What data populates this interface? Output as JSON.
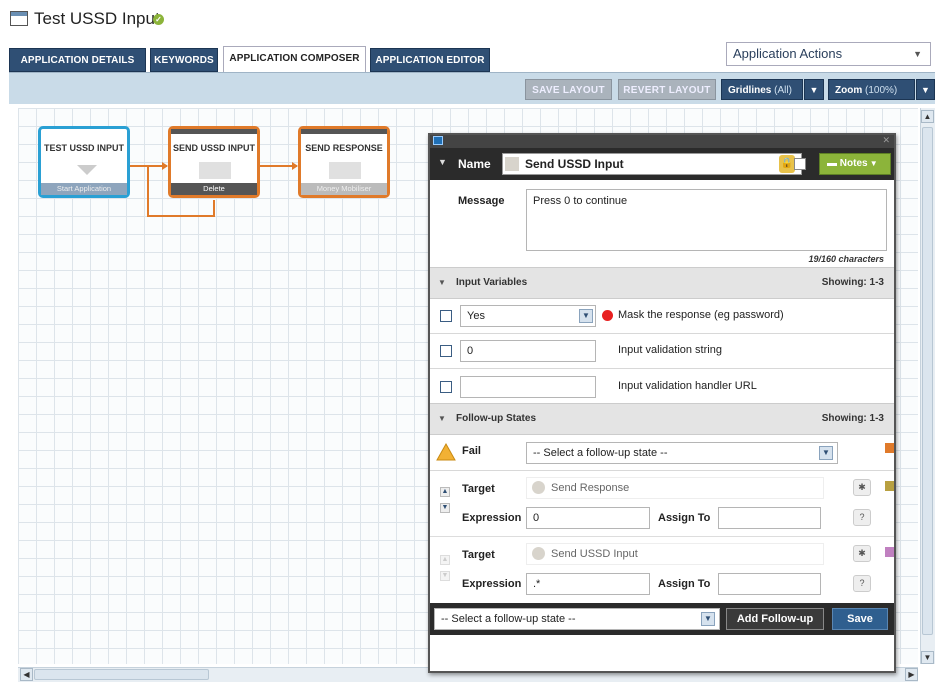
{
  "window": {
    "title": "Test USSD Input"
  },
  "tabs": [
    {
      "label": "APPLICATION DETAILS"
    },
    {
      "label": "KEYWORDS"
    },
    {
      "label": "APPLICATION COMPOSER",
      "active": true
    },
    {
      "label": "APPLICATION EDITOR"
    }
  ],
  "actions": {
    "label": "Application Actions"
  },
  "toolbar": {
    "save_layout": "SAVE LAYOUT",
    "revert_layout": "REVERT LAYOUT",
    "gridlines_label": "Gridlines",
    "gridlines_value": "(All)",
    "zoom_label": "Zoom",
    "zoom_value": "(100%)"
  },
  "nodes": [
    {
      "title": "TEST USSD INPUT",
      "footer": "Start Application",
      "border_color": "#2aa0d4"
    },
    {
      "title": "SEND USSD INPUT",
      "footer": "Delete",
      "border_color": "#e07a2a"
    },
    {
      "title": "SEND RESPONSE",
      "footer": "Money Mobiliser",
      "border_color": "#e07a2a"
    }
  ],
  "panel": {
    "name_label": "Name",
    "name_value": "Send USSD Input",
    "notes_label": "Notes",
    "message_label": "Message",
    "message_value": "Press 0 to continue",
    "char_count": "19/160 characters",
    "input_vars": {
      "title": "Input Variables",
      "showing": "Showing: 1-3",
      "rows": [
        {
          "value": "Yes",
          "label": "Mask the response (eg password)"
        },
        {
          "value": "0",
          "label": "Input validation string"
        },
        {
          "value": "",
          "label": "Input validation handler URL"
        }
      ]
    },
    "followups": {
      "title": "Follow-up States",
      "showing": "Showing: 1-3",
      "fail_label": "Fail",
      "fail_select": "-- Select a follow-up state --",
      "states": [
        {
          "target_label": "Target",
          "target_value": "Send Response",
          "expression_label": "Expression",
          "expression_value": "0",
          "assign_label": "Assign To",
          "assign_value": "",
          "color": "#b8a040"
        },
        {
          "target_label": "Target",
          "target_value": "Send USSD Input",
          "expression_label": "Expression",
          "expression_value": ".*",
          "assign_label": "Assign To",
          "assign_value": "",
          "color": "#c080c0"
        }
      ]
    },
    "footer": {
      "select_placeholder": "-- Select a follow-up state --",
      "add_button": "Add Follow-up",
      "save_button": "Save"
    }
  },
  "colors": {
    "brand": "#2f4f74",
    "accent": "#8cb43a",
    "fail_marker": "#e07a2a"
  }
}
